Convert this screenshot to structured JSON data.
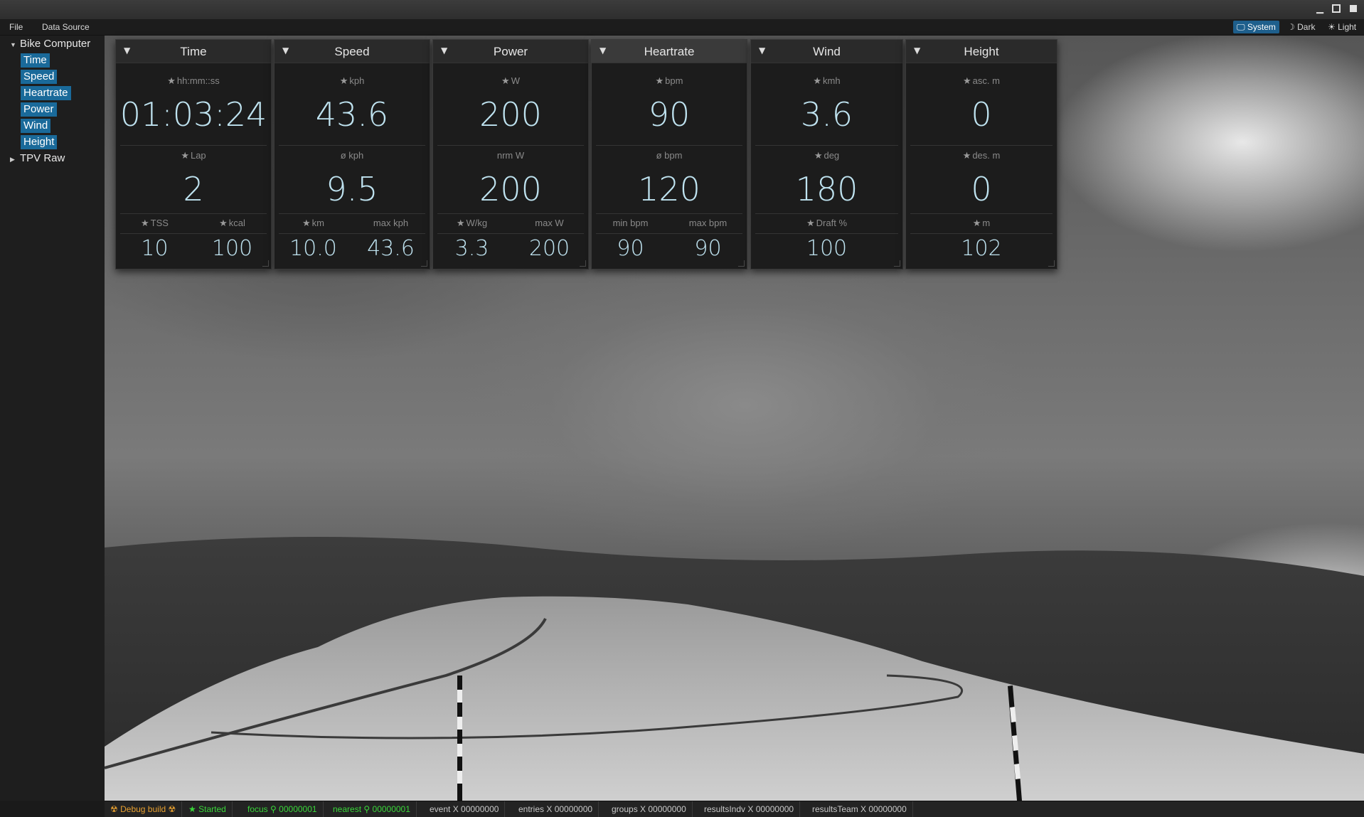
{
  "menu": {
    "file": "File",
    "data_source": "Data Source"
  },
  "theme": {
    "system": "System",
    "dark": "Dark",
    "light": "Light",
    "system_icon": "monitor-icon",
    "dark_icon": "moon-icon",
    "light_icon": "sun-icon"
  },
  "sidebar": {
    "root": "Bike Computer",
    "children": [
      "Time",
      "Speed",
      "Heartrate",
      "Power",
      "Wind",
      "Height"
    ],
    "raw": "TPV Raw"
  },
  "cards": [
    {
      "title": "Time",
      "top_label": "hh:mm::ss",
      "top_value": "01:03:24",
      "mid_label": "Lap",
      "mid_value": "2",
      "bl_label": "TSS",
      "bl_value": "10",
      "br_label": "kcal",
      "br_value": "100"
    },
    {
      "title": "Speed",
      "top_label": "kph",
      "top_value": "43.6",
      "mid_label": "ø kph",
      "mid_value": "9.5",
      "bl_label": "km",
      "bl_value": "10.0",
      "br_label": "max kph",
      "br_value": "43.6"
    },
    {
      "title": "Power",
      "top_label": "W",
      "top_value": "200",
      "mid_label": "nrm W",
      "mid_value": "200",
      "bl_label": "W/kg",
      "bl_value": "3.3",
      "br_label": "max W",
      "br_value": "200"
    },
    {
      "title": "Heartrate",
      "top_label": "bpm",
      "top_value": "90",
      "mid_label": "ø bpm",
      "mid_value": "120",
      "bl_label": "min bpm",
      "bl_value": "90",
      "br_label": "max bpm",
      "br_value": "90"
    },
    {
      "title": "Wind",
      "top_label": "kmh",
      "top_value": "3.6",
      "mid_label": "deg",
      "mid_value": "180",
      "bot_label": "Draft %",
      "bot_value": "100"
    },
    {
      "title": "Height",
      "top_label": "asc. m",
      "top_value": "0",
      "mid_label": "des. m",
      "mid_value": "0",
      "bot_label": "m",
      "bot_value": "102"
    }
  ],
  "status": {
    "debug": "Debug build",
    "started": "Started",
    "focus": "focus",
    "focus_id": "00000001",
    "nearest": "nearest",
    "nearest_id": "00000001",
    "event": "event X 00000000",
    "entries": "entries X 00000000",
    "groups": "groups X 00000000",
    "results_indv": "resultsIndv X 00000000",
    "results_team": "resultsTeam X 00000000"
  },
  "colors": {
    "accent": "#1a6a9a",
    "value_text": "#bfe3f0",
    "status_green": "#39d639",
    "status_orange": "#e8a030"
  }
}
